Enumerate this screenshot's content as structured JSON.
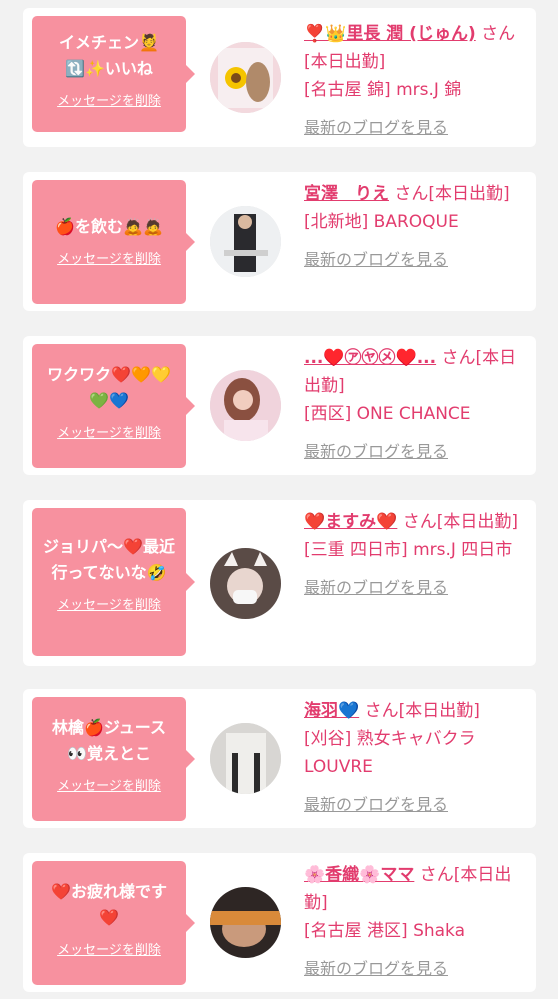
{
  "cards": [
    {
      "message": "イメチェン💆\n🔃✨いいね",
      "delete_label": "メッセージを削除",
      "name": "❣️👑里長 潤 (じゅん)",
      "suffix": " さん[本日出勤]",
      "shop": "[名古屋 錦] mrs.J 錦",
      "blog": "最新のブログを見る"
    },
    {
      "message": "🍎を飲む🙇🙇",
      "delete_label": "メッセージを削除",
      "name": "宮澤　りえ",
      "suffix": " さん[本日出勤]",
      "shop": "[北新地] BAROQUE",
      "blog": "最新のブログを見る"
    },
    {
      "message": "ワクワク❤️🧡💛\n💚💙",
      "delete_label": "メッセージを削除",
      "name": "...♥️㋐㋳㋱♥️...",
      "suffix": " さん[本日出勤]",
      "shop": "[西区] ONE CHANCE",
      "blog": "最新のブログを見る"
    },
    {
      "message": "ジョリパ〜❤️最近\n行ってないな🤣",
      "delete_label": "メッセージを削除",
      "name": "❤️ますみ❤️",
      "suffix": " さん[本日出勤]",
      "shop": "[三重 四日市] mrs.J 四日市",
      "blog": "最新のブログを見る"
    },
    {
      "message": "林檎🍎ジュース\n👀覚えとこ",
      "delete_label": "メッセージを削除",
      "name": "海羽💙",
      "suffix": " さん[本日出勤]",
      "shop": "[刈谷] 熟女キャバクラ LOUVRE",
      "blog": "最新のブログを見る"
    },
    {
      "message": "❤️お疲れ様です\n❤️",
      "delete_label": "メッセージを削除",
      "name": "🌸香織🌸ママ",
      "suffix": " さん[本日出勤]",
      "shop": "[名古屋 港区] Shaka",
      "blog": "最新のブログを見る"
    }
  ],
  "colors": {
    "accent": "#e23c6e",
    "bubble": "#f7919f"
  }
}
